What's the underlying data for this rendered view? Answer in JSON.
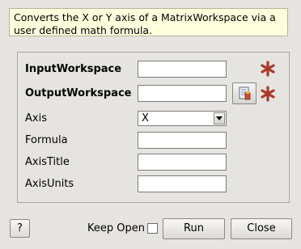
{
  "description": "Converts the X or Y axis of a MatrixWorkspace via a user defined math formula.",
  "properties": {
    "input_workspace": {
      "label": "InputWorkspace",
      "value": "",
      "required": true
    },
    "output_workspace": {
      "label": "OutputWorkspace",
      "value": "",
      "required": true
    },
    "axis": {
      "label": "Axis",
      "selected": "X"
    },
    "formula": {
      "label": "Formula",
      "value": ""
    },
    "axis_title": {
      "label": "AxisTitle",
      "value": ""
    },
    "axis_units": {
      "label": "AxisUnits",
      "value": ""
    }
  },
  "footer": {
    "help_label": "?",
    "keep_open_label": "Keep Open",
    "keep_open_checked": false,
    "run_label": "Run",
    "close_label": "Close"
  },
  "colors": {
    "required_star": "#a83a2a",
    "description_bg": "#ffffdd",
    "dialog_bg": "#e6e4e1"
  },
  "icons": {
    "required": "asterisk-icon",
    "browse": "workspace-browse-icon"
  }
}
